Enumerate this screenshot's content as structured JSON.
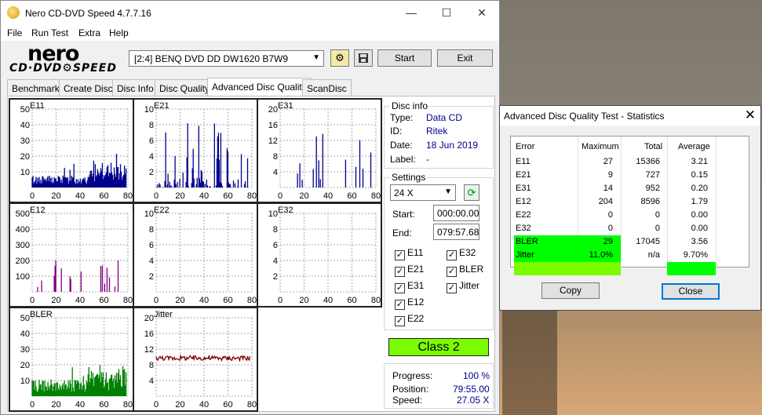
{
  "app": {
    "title": "Nero CD-DVD Speed 4.7.7.16",
    "minimize": "—",
    "maximize": "☐",
    "close": "✕"
  },
  "menu": [
    "File",
    "Run Test",
    "Extra",
    "Help"
  ],
  "logo": {
    "line1": "nero",
    "line2": "CD·DVD⚙SPEED"
  },
  "drive": {
    "selected": "[2:4]  BENQ DVD DD DW1620 B7W9"
  },
  "toolbar": {
    "start": "Start",
    "exit": "Exit"
  },
  "tabs": [
    "Benchmark",
    "Create Disc",
    "Disc Info",
    "Disc Quality",
    "Advanced Disc Quality",
    "ScanDisc"
  ],
  "disc_info": {
    "heading": "Disc info",
    "type_label": "Type:",
    "type": "Data CD",
    "id_label": "ID:",
    "id": "Ritek",
    "date_label": "Date:",
    "date": "18 Jun 2019",
    "label_label": "Label:",
    "label": "-"
  },
  "settings": {
    "heading": "Settings",
    "speed": "24 X",
    "start_label": "Start:",
    "start": "000:00.00",
    "end_label": "End:",
    "end": "079:57.68"
  },
  "checkboxes": [
    {
      "label": "E11",
      "checked": true
    },
    {
      "label": "E32",
      "checked": true
    },
    {
      "label": "E21",
      "checked": true
    },
    {
      "label": "BLER",
      "checked": true
    },
    {
      "label": "E31",
      "checked": true
    },
    {
      "label": "Jitter",
      "checked": true
    },
    {
      "label": "E12",
      "checked": true
    },
    {
      "label": "E22",
      "checked": true
    }
  ],
  "class": "Class 2",
  "progress": {
    "progress_label": "Progress:",
    "progress": "100 %",
    "position_label": "Position:",
    "position": "79:55.00",
    "speed_label": "Speed:",
    "speed": "27.05 X"
  },
  "graphs": [
    {
      "name": "E11",
      "yticks": [
        "50",
        "40",
        "30",
        "20",
        "10"
      ],
      "xticks": [
        "0",
        "20",
        "40",
        "60",
        "80"
      ],
      "color": "#00008b"
    },
    {
      "name": "E21",
      "yticks": [
        "10",
        "8",
        "6",
        "4",
        "2"
      ],
      "xticks": [
        "0",
        "20",
        "40",
        "60",
        "80"
      ],
      "color": "#00008b"
    },
    {
      "name": "E31",
      "yticks": [
        "20",
        "16",
        "12",
        "8",
        "4"
      ],
      "xticks": [
        "0",
        "20",
        "40",
        "60",
        "80"
      ],
      "color": "#00008b"
    },
    {
      "name": "E12",
      "yticks": [
        "500",
        "400",
        "300",
        "200",
        "100"
      ],
      "xticks": [
        "0",
        "20",
        "40",
        "60",
        "80"
      ],
      "color": "#800080"
    },
    {
      "name": "E22",
      "yticks": [
        "10",
        "8",
        "6",
        "4",
        "2"
      ],
      "xticks": [
        "0",
        "20",
        "40",
        "60",
        "80"
      ],
      "color": "#800080"
    },
    {
      "name": "E32",
      "yticks": [
        "10",
        "8",
        "6",
        "4",
        "2"
      ],
      "xticks": [
        "0",
        "20",
        "40",
        "60",
        "80"
      ],
      "color": "#800080"
    },
    {
      "name": "BLER",
      "yticks": [
        "50",
        "40",
        "30",
        "20",
        "10"
      ],
      "xticks": [
        "0",
        "20",
        "40",
        "60",
        "80"
      ],
      "color": "#008000"
    },
    {
      "name": "Jitter",
      "yticks": [
        "20",
        "16",
        "12",
        "8",
        "4"
      ],
      "xticks": [
        "0",
        "20",
        "40",
        "60",
        "80"
      ],
      "color": "#800000"
    }
  ],
  "stats": {
    "title": "Advanced Disc Quality Test - Statistics",
    "close_glyph": "✕",
    "headers": [
      "Error",
      "Maximum",
      "Total",
      "Average"
    ],
    "rows": [
      {
        "error": "E11",
        "maximum": "27",
        "total": "15366",
        "average": "3.21"
      },
      {
        "error": "E21",
        "maximum": "9",
        "total": "727",
        "average": "0.15"
      },
      {
        "error": "E31",
        "maximum": "14",
        "total": "952",
        "average": "0.20"
      },
      {
        "error": "E12",
        "maximum": "204",
        "total": "8596",
        "average": "1.79"
      },
      {
        "error": "E22",
        "maximum": "0",
        "total": "0",
        "average": "0.00"
      },
      {
        "error": "E32",
        "maximum": "0",
        "total": "0",
        "average": "0.00"
      },
      {
        "error": "BLER",
        "maximum": "29",
        "total": "17045",
        "average": "3.56"
      },
      {
        "error": "Jitter",
        "maximum": "11.0%",
        "total": "n/a",
        "average": "9.70%"
      }
    ],
    "copy": "Copy",
    "close": "Close",
    "highlight_green": "#00ff00",
    "highlight_lime": "#7cfc00"
  }
}
